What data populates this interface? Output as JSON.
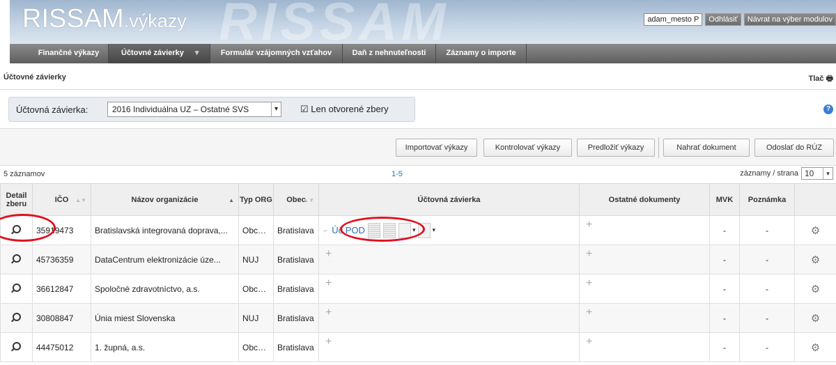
{
  "app": {
    "logo_main": "RISSAM",
    "logo_suffix": ".výkazy",
    "bg_word": "RISSAM"
  },
  "user": {
    "name": "adam_mesto P",
    "logout": "Odhlásiť",
    "back": "Návrat na výber modulov"
  },
  "menu": [
    "Finančné výkazy",
    "Účtovné závierky",
    "Formulár vzájomných vzťahov",
    "Daň z nehnuteľnosti",
    "Záznamy o importe"
  ],
  "breadcrumb": {
    "title": "Účtovné závierky",
    "print": "Tlač"
  },
  "filter": {
    "label": "Účtovná závierka:",
    "selected": "2016 Individuálna UZ – Ostatné SVS",
    "checkbox": "Len otvorené zbery"
  },
  "toolbar": {
    "import": "Importovať výkazy",
    "control": "Kontrolovať výkazy",
    "submit": "Predložiť výkazy",
    "upload": "Nahrať dokument",
    "send": "Odoslať do RÚZ"
  },
  "pager": {
    "count": "5 záznamov",
    "range": "1-5",
    "per_page_label": "záznamy / strana",
    "per_page": "10"
  },
  "columns": {
    "detail": "Detail zberu",
    "ico": "IČO",
    "name": "Názov organizácie",
    "type": "Typ ORG",
    "city": "Obec",
    "statement": "Účtovná závierka",
    "other": "Ostatné dokumenty",
    "mvk": "MVK",
    "note": "Poznámka"
  },
  "first_row_statement": "Úč POD",
  "rows": [
    {
      "ico": "35919473",
      "name": "Bratislavská integrovaná doprava,...",
      "type": "Obch. ...",
      "city": "Bratislava",
      "mvk": "-",
      "note": "-"
    },
    {
      "ico": "45736359",
      "name": "DataCentrum elektronizácie úze...",
      "type": "NUJ",
      "city": "Bratislava",
      "mvk": "-",
      "note": "-"
    },
    {
      "ico": "36612847",
      "name": "Spoločné zdravotníctvo, a.s.",
      "type": "Obch. ...",
      "city": "Bratislava",
      "mvk": "-",
      "note": "-"
    },
    {
      "ico": "30808847",
      "name": "Únia miest Slovenska",
      "type": "NUJ",
      "city": "Bratislava",
      "mvk": "-",
      "note": "-"
    },
    {
      "ico": "44475012",
      "name": "1. župná, a.s.",
      "type": "Obch. ...",
      "city": "Bratislava",
      "mvk": "-",
      "note": "-"
    }
  ]
}
